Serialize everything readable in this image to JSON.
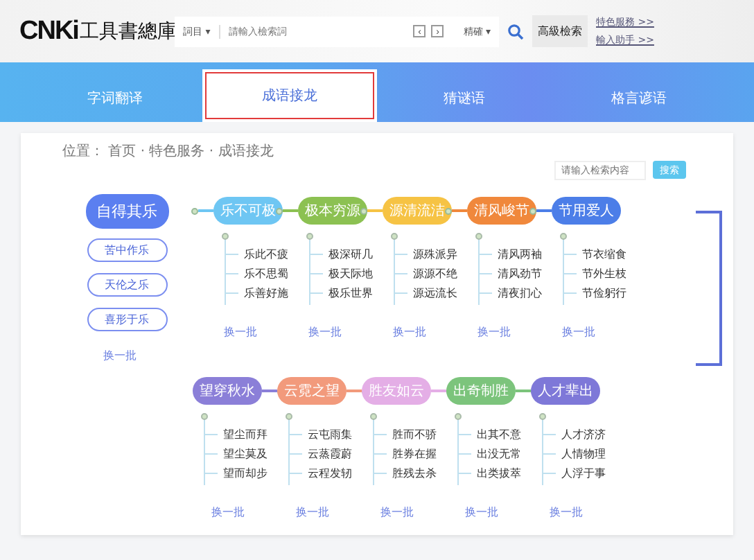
{
  "header": {
    "logo_mark": "CNKi",
    "logo_text": "工具書總庫",
    "scope": "詞目 ▾",
    "search_placeholder": "請輸入檢索詞",
    "key_buttons": [
      "‹",
      "›"
    ],
    "match": "精確 ▾",
    "advanced_button": "高級檢索",
    "links": [
      "特色服務 >>",
      "輸入助手 >>"
    ]
  },
  "tabs": [
    {
      "label": "字词翻译",
      "selected": false
    },
    {
      "label": "成语接龙",
      "selected": true
    },
    {
      "label": "猜谜语",
      "selected": false
    },
    {
      "label": "格言谚语",
      "selected": false
    }
  ],
  "breadcrumb": "位置： 首页 · 特色服务 · 成语接龙",
  "filter": {
    "placeholder": "请输入检索内容",
    "button": "搜索"
  },
  "start": {
    "label": "自得其乐",
    "color": "#5b7ff0",
    "options": [
      "苦中作乐",
      "天伦之乐",
      "喜形于乐"
    ],
    "more": "换一批"
  },
  "chain_rows": [
    [
      {
        "label": "乐不可极",
        "color": "#6ec6f3",
        "children": [
          "乐此不疲",
          "乐不思蜀",
          "乐善好施"
        ],
        "more": "换一批"
      },
      {
        "label": "极本穷源",
        "color": "#8cc152",
        "children": [
          "极深研几",
          "极天际地",
          "极乐世界"
        ],
        "more": "换一批"
      },
      {
        "label": "源清流洁",
        "color": "#f6c344",
        "children": [
          "源殊派异",
          "源源不绝",
          "源远流长"
        ],
        "more": "换一批"
      },
      {
        "label": "清风峻节",
        "color": "#f0883c",
        "children": [
          "清风两袖",
          "清风劲节",
          "清夜扪心"
        ],
        "more": "换一批"
      },
      {
        "label": "节用爱人",
        "color": "#4c7ee8",
        "children": [
          "节衣缩食",
          "节外生枝",
          "节俭躬行"
        ],
        "more": "换一批"
      }
    ],
    [
      {
        "label": "望穿秋水",
        "color": "#8b7fd8",
        "children": [
          "望尘而拜",
          "望尘莫及",
          "望而却步"
        ],
        "more": "换一批"
      },
      {
        "label": "云霓之望",
        "color": "#f29a7c",
        "children": [
          "云屯雨集",
          "云蒸霞蔚",
          "云程发轫"
        ],
        "more": "换一批"
      },
      {
        "label": "胜友如云",
        "color": "#e4aee6",
        "children": [
          "胜而不骄",
          "胜券在握",
          "胜残去杀"
        ],
        "more": "换一批"
      },
      {
        "label": "出奇制胜",
        "color": "#7cc47c",
        "children": [
          "出其不意",
          "出没无常",
          "出类拔萃"
        ],
        "more": "换一批"
      },
      {
        "label": "人才辈出",
        "color": "#7e78d8",
        "children": [
          "人才济济",
          "人情物理",
          "人浮于事"
        ],
        "more": "换一批"
      }
    ]
  ]
}
